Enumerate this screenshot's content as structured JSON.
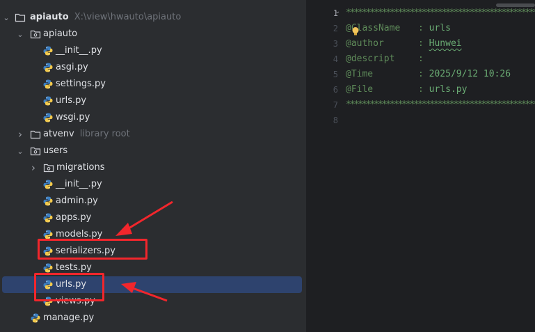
{
  "project_tree": {
    "root": {
      "name": "apiauto",
      "path": "X:\\view\\hwauto\\apiauto"
    },
    "rows": [
      {
        "label": "apiauto",
        "kind": "folder",
        "expanded": true,
        "depth": 1
      },
      {
        "label": "__init__.py",
        "kind": "python",
        "depth": 2
      },
      {
        "label": "asgi.py",
        "kind": "python",
        "depth": 2
      },
      {
        "label": "settings.py",
        "kind": "python",
        "depth": 2
      },
      {
        "label": "urls.py",
        "kind": "python",
        "depth": 2
      },
      {
        "label": "wsgi.py",
        "kind": "python",
        "depth": 2
      },
      {
        "label": "atvenv",
        "hint": "library root",
        "kind": "folder",
        "expanded": false,
        "depth": 1
      },
      {
        "label": "users",
        "kind": "folder",
        "expanded": true,
        "depth": 1
      },
      {
        "label": "migrations",
        "kind": "folder",
        "expanded": false,
        "depth": 2
      },
      {
        "label": "__init__.py",
        "kind": "python",
        "depth": 2
      },
      {
        "label": "admin.py",
        "kind": "python",
        "depth": 2
      },
      {
        "label": "apps.py",
        "kind": "python",
        "depth": 2
      },
      {
        "label": "models.py",
        "kind": "python",
        "depth": 2
      },
      {
        "label": "serializers.py",
        "kind": "python",
        "depth": 2
      },
      {
        "label": "tests.py",
        "kind": "python",
        "depth": 2
      },
      {
        "label": "urls.py",
        "kind": "python",
        "depth": 2,
        "selected": true
      },
      {
        "label": "views.py",
        "kind": "python",
        "depth": 2
      },
      {
        "label": "manage.py",
        "kind": "python",
        "depth": 1
      }
    ]
  },
  "editor": {
    "line_numbers": [
      "1",
      "2",
      "3",
      "4",
      "5",
      "6",
      "7",
      "8"
    ],
    "separator": "********************************************************",
    "lines": [
      {
        "key": "@ClassName",
        "value": "urls"
      },
      {
        "key": "@author",
        "value": "Hunwei"
      },
      {
        "key": "@descript",
        "value": ""
      },
      {
        "key": "@Time",
        "value": "2025/9/12 10:26"
      },
      {
        "key": "@File",
        "value": "urls.py"
      }
    ]
  },
  "colors": {
    "selection": "#2e436e",
    "annotation_red": "#f2262c",
    "comment_green": "#6aab73"
  }
}
